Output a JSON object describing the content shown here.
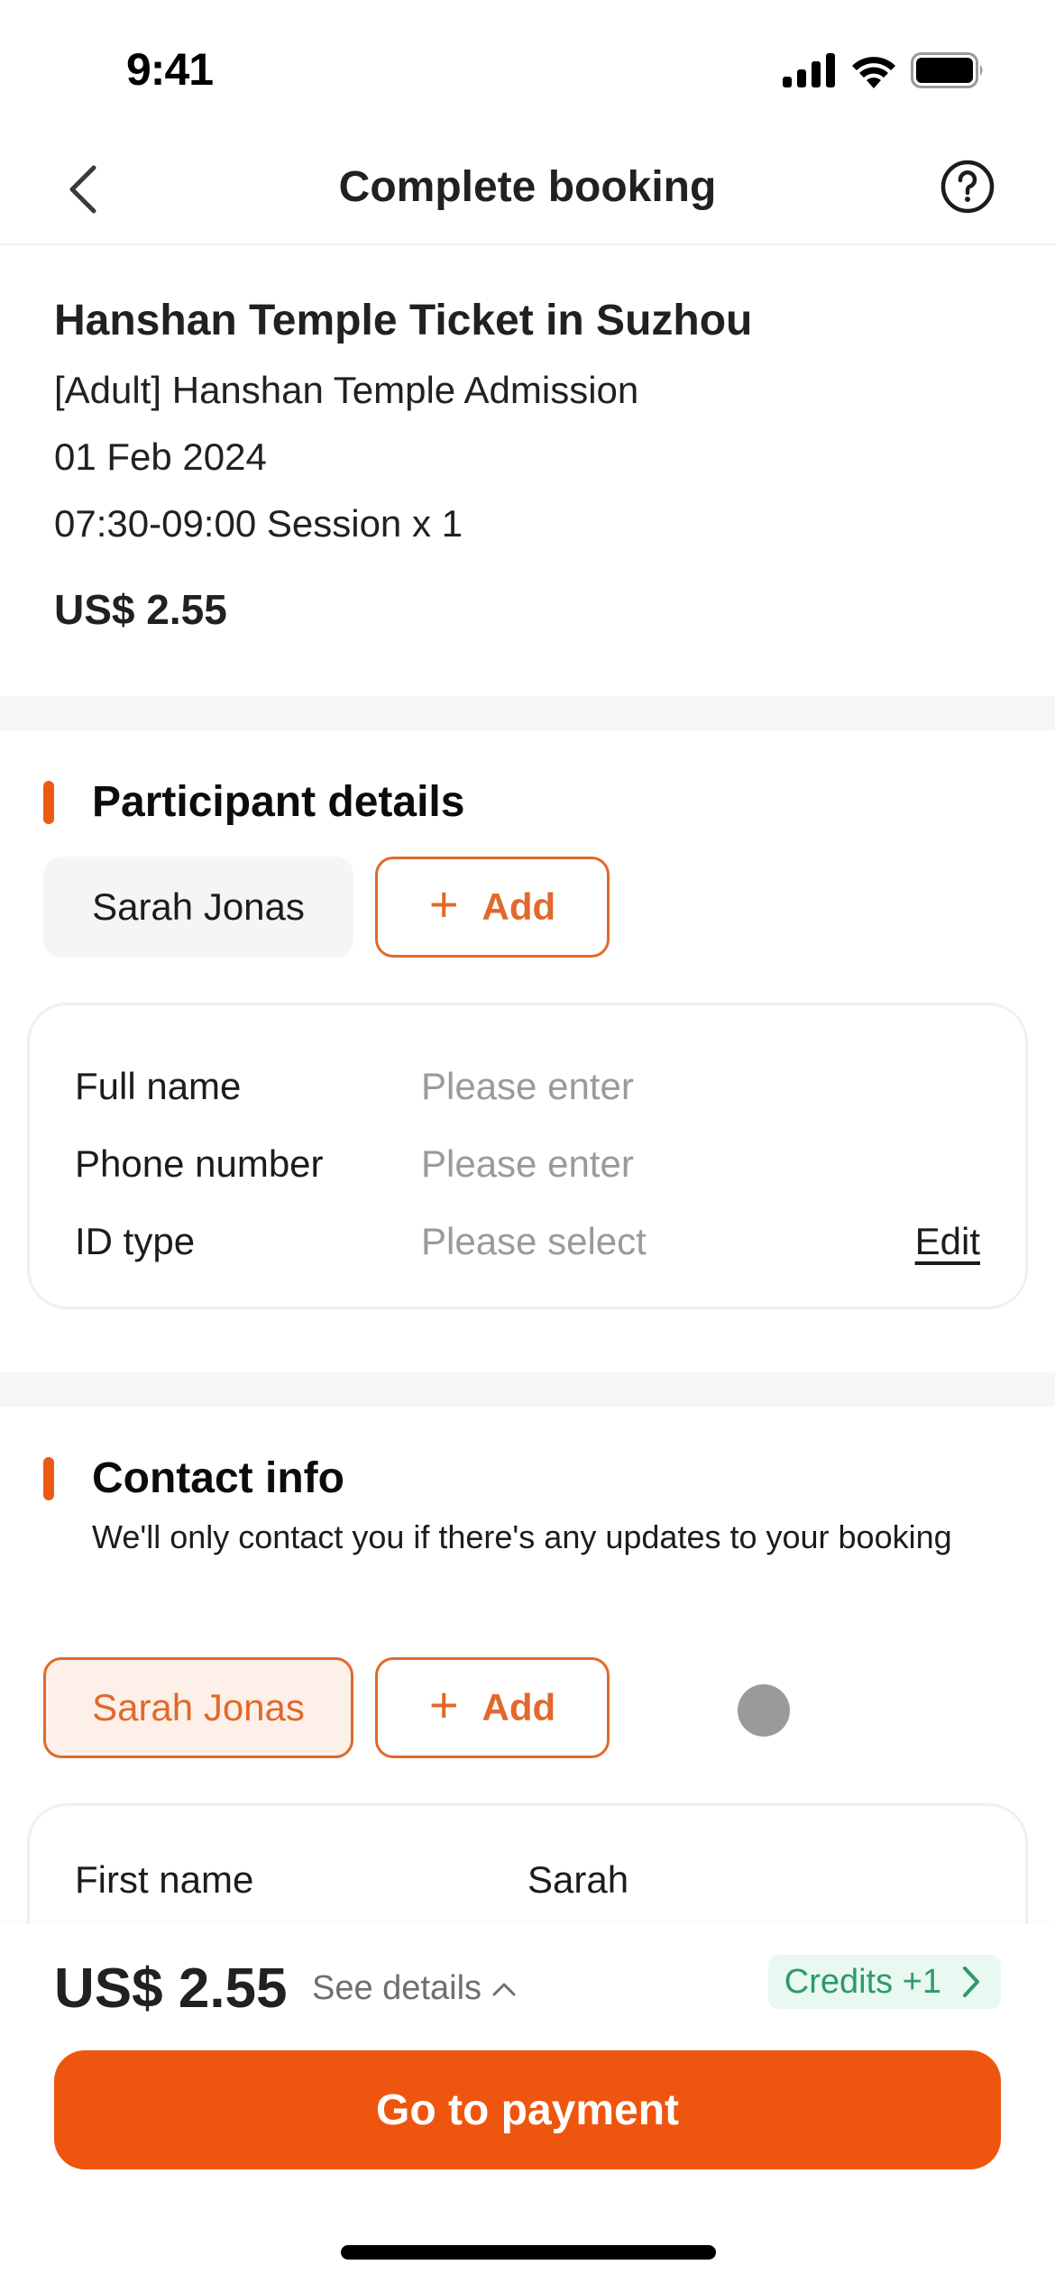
{
  "status_bar": {
    "time": "9:41",
    "icons": [
      "signal-icon",
      "wifi-icon",
      "battery-icon"
    ]
  },
  "nav": {
    "back_icon": "chevron-left-icon",
    "title": "Complete booking",
    "help_icon": "question-circle-icon"
  },
  "product": {
    "title": "Hanshan Temple Ticket in Suzhou",
    "package": "[Adult] Hanshan Temple Admission",
    "date": "01 Feb 2024",
    "session": "07:30-09:00 Session x 1",
    "price": "US$ 2.55"
  },
  "participant": {
    "title": "Participant details",
    "chips": [
      {
        "label": "Sarah Jonas",
        "selected": false
      }
    ],
    "add_label": "Add",
    "fields": [
      {
        "label": "Full name",
        "placeholder": "Please enter",
        "value": ""
      },
      {
        "label": "Phone number",
        "placeholder": "Please enter",
        "value": ""
      },
      {
        "label": "ID type",
        "placeholder": "Please select",
        "value": ""
      }
    ],
    "edit_label": "Edit"
  },
  "contact": {
    "title": "Contact info",
    "subtitle": "We'll only contact you if there's any updates to your booking",
    "chips": [
      {
        "label": "Sarah Jonas",
        "selected": true
      }
    ],
    "add_label": "Add",
    "fields": [
      {
        "label": "First name",
        "value": "Sarah"
      }
    ]
  },
  "footer": {
    "total": "US$ 2.55",
    "see_details": "See details",
    "credits": "Credits +1",
    "pay_label": "Go to payment"
  },
  "colors": {
    "accent": "#ee560f",
    "accent_border": "#e0692b",
    "credits_green": "#2b9b6a",
    "credits_bg": "#e9f8f1"
  }
}
